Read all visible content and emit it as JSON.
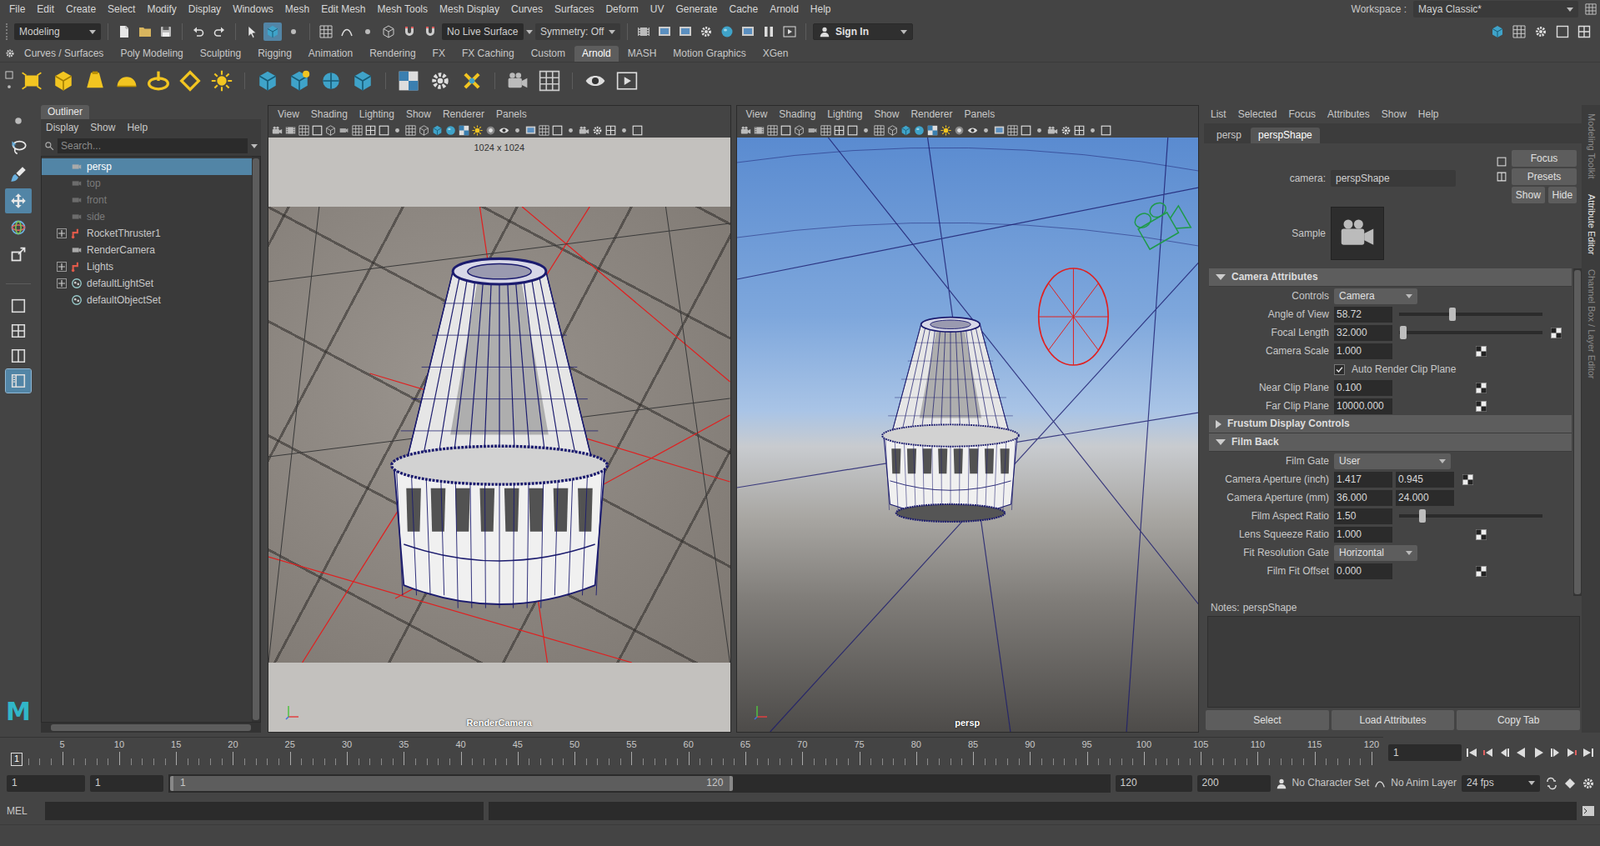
{
  "menubar": {
    "items": [
      "File",
      "Edit",
      "Create",
      "Select",
      "Modify",
      "Display",
      "Windows",
      "Mesh",
      "Edit Mesh",
      "Mesh Tools",
      "Mesh Display",
      "Curves",
      "Surfaces",
      "Deform",
      "UV",
      "Generate",
      "Cache",
      "Arnold",
      "Help"
    ],
    "workspace_label": "Workspace :",
    "workspace": "Maya Classic*"
  },
  "status_line": {
    "mode": "Modeling",
    "live_surface": "No Live Surface",
    "symmetry": "Symmetry: Off",
    "sign_in": "Sign In"
  },
  "shelf": {
    "tabs": [
      {
        "label": "Curves / Surfaces",
        "selected": false
      },
      {
        "label": "Poly Modeling",
        "selected": false
      },
      {
        "label": "Sculpting",
        "selected": false
      },
      {
        "label": "Rigging",
        "selected": false
      },
      {
        "label": "Animation",
        "selected": false
      },
      {
        "label": "Rendering",
        "selected": false
      },
      {
        "label": "FX",
        "selected": false
      },
      {
        "label": "FX Caching",
        "selected": false
      },
      {
        "label": "Custom",
        "selected": false
      },
      {
        "label": "Arnold",
        "selected": true
      },
      {
        "label": "MASH",
        "selected": false
      },
      {
        "label": "Motion Graphics",
        "selected": false
      },
      {
        "label": "XGen",
        "selected": false
      }
    ]
  },
  "toolbox": {
    "tools": [
      {
        "kind": "select",
        "selected": false
      },
      {
        "kind": "lasso",
        "selected": false
      },
      {
        "kind": "paint",
        "selected": false
      },
      {
        "kind": "move",
        "selected": true
      },
      {
        "kind": "rotate",
        "selected": false
      },
      {
        "kind": "scale",
        "selected": false
      }
    ],
    "layouts": [
      {
        "kind": "single",
        "selected": false
      },
      {
        "kind": "four",
        "selected": false
      },
      {
        "kind": "two-side",
        "selected": false
      },
      {
        "kind": "outliner-persp",
        "selected": true
      }
    ]
  },
  "logo": "M",
  "outliner": {
    "title": "Outliner",
    "menu": [
      "Display",
      "Show",
      "Help"
    ],
    "search": {
      "placeholder": "Search..."
    },
    "items": [
      {
        "label": "persp",
        "kind": "camera",
        "selected": true,
        "dimmed": false,
        "has_children": false,
        "expanded": false
      },
      {
        "label": "top",
        "kind": "camera",
        "selected": false,
        "dimmed": true,
        "has_children": false,
        "expanded": false
      },
      {
        "label": "front",
        "kind": "camera",
        "selected": false,
        "dimmed": true,
        "has_children": false,
        "expanded": false
      },
      {
        "label": "side",
        "kind": "camera",
        "selected": false,
        "dimmed": true,
        "has_children": false,
        "expanded": false
      },
      {
        "label": "RocketThruster1",
        "kind": "group",
        "selected": false,
        "dimmed": false,
        "has_children": true,
        "expanded": false
      },
      {
        "label": "RenderCamera",
        "kind": "camera",
        "selected": false,
        "dimmed": false,
        "has_children": false,
        "expanded": false
      },
      {
        "label": "Lights",
        "kind": "group",
        "selected": false,
        "dimmed": false,
        "has_children": true,
        "expanded": false
      },
      {
        "label": "defaultLightSet",
        "kind": "set",
        "selected": false,
        "dimmed": false,
        "has_children": true,
        "expanded": false
      },
      {
        "label": "defaultObjectSet",
        "kind": "set",
        "selected": false,
        "dimmed": false,
        "has_children": false,
        "expanded": false
      }
    ]
  },
  "viewports": [
    {
      "menu": [
        "View",
        "Shading",
        "Lighting",
        "Show",
        "Renderer",
        "Panels"
      ],
      "camera": "RenderCamera",
      "resolution": "1024 x 1024",
      "kind": "render-camera"
    },
    {
      "menu": [
        "View",
        "Shading",
        "Lighting",
        "Show",
        "Renderer",
        "Panels"
      ],
      "camera": "persp",
      "kind": "perspective"
    }
  ],
  "attribute_editor": {
    "menu": [
      "List",
      "Selected",
      "Focus",
      "Attributes",
      "Show",
      "Help"
    ],
    "tabs": [
      {
        "label": "persp",
        "selected": false
      },
      {
        "label": "perspShape",
        "selected": true
      }
    ],
    "node_label": "camera:",
    "node_name": "perspShape",
    "buttons": [
      "Focus",
      "Presets"
    ],
    "show_hide": [
      "Show",
      "Hide"
    ],
    "sample_label": "Sample",
    "sections": [
      {
        "title": "Camera Attributes",
        "expanded": true,
        "rows": [
          {
            "kind": "dropdown",
            "label": "Controls",
            "value": "Camera"
          },
          {
            "kind": "slider",
            "label": "Angle of View",
            "value": "58.72",
            "level": 0.37,
            "map": false
          },
          {
            "kind": "slider",
            "label": "Focal Length",
            "value": "32.000",
            "level": 0.03,
            "map": true
          },
          {
            "kind": "field",
            "label": "Camera Scale",
            "value": "1.000",
            "map": true
          },
          {
            "kind": "checkbox",
            "label": "Auto Render Clip Plane",
            "checked": true
          },
          {
            "kind": "field",
            "label": "Near Clip Plane",
            "value": "0.100",
            "map": true
          },
          {
            "kind": "field",
            "label": "Far Clip Plane",
            "value": "10000.000",
            "map": true
          }
        ]
      },
      {
        "title": "Frustum Display Controls",
        "expanded": false,
        "rows": []
      },
      {
        "title": "Film Back",
        "expanded": true,
        "rows": [
          {
            "kind": "dropdown",
            "label": "Film Gate",
            "value": "User"
          },
          {
            "kind": "pair",
            "label": "Camera Aperture (inch)",
            "values": [
              "1.417",
              "0.945"
            ],
            "map": true
          },
          {
            "kind": "pair",
            "label": "Camera Aperture (mm)",
            "values": [
              "36.000",
              "24.000"
            ],
            "map": false
          },
          {
            "kind": "slider",
            "label": "Film Aspect Ratio",
            "value": "1.50",
            "level": 0.16,
            "map": false
          },
          {
            "kind": "field",
            "label": "Lens Squeeze Ratio",
            "value": "1.000",
            "map": true
          },
          {
            "kind": "dropdown",
            "label": "Fit Resolution Gate",
            "value": "Horizontal"
          },
          {
            "kind": "field",
            "label": "Film Fit Offset",
            "value": "0.000",
            "map": true
          }
        ]
      }
    ],
    "notes_label": "Notes:",
    "notes_node": "perspShape",
    "footer": [
      "Select",
      "Load Attributes",
      "Copy Tab"
    ]
  },
  "right_tabs": [
    {
      "label": "Modeling Toolkit",
      "selected": false
    },
    {
      "label": "Attribute Editor",
      "selected": true
    },
    {
      "label": "Channel Box / Layer Editor",
      "selected": false
    }
  ],
  "timeline": {
    "ticks": [
      "5",
      "10",
      "15",
      "20",
      "25",
      "30",
      "35",
      "40",
      "45",
      "50",
      "55",
      "60",
      "65",
      "70",
      "75",
      "80",
      "85",
      "90",
      "95",
      "100",
      "105",
      "110",
      "115",
      "120"
    ],
    "marker": "1",
    "current_frame": "1"
  },
  "range": {
    "start": "1",
    "playback_start": "1",
    "slider_start": "1",
    "slider_end": "120",
    "level": 0.6,
    "playback_end": "120",
    "end": "200",
    "character_set": "No Character Set",
    "anim_layer": "No Anim Layer",
    "fps": "24 fps"
  },
  "command_line": {
    "language": "MEL"
  }
}
